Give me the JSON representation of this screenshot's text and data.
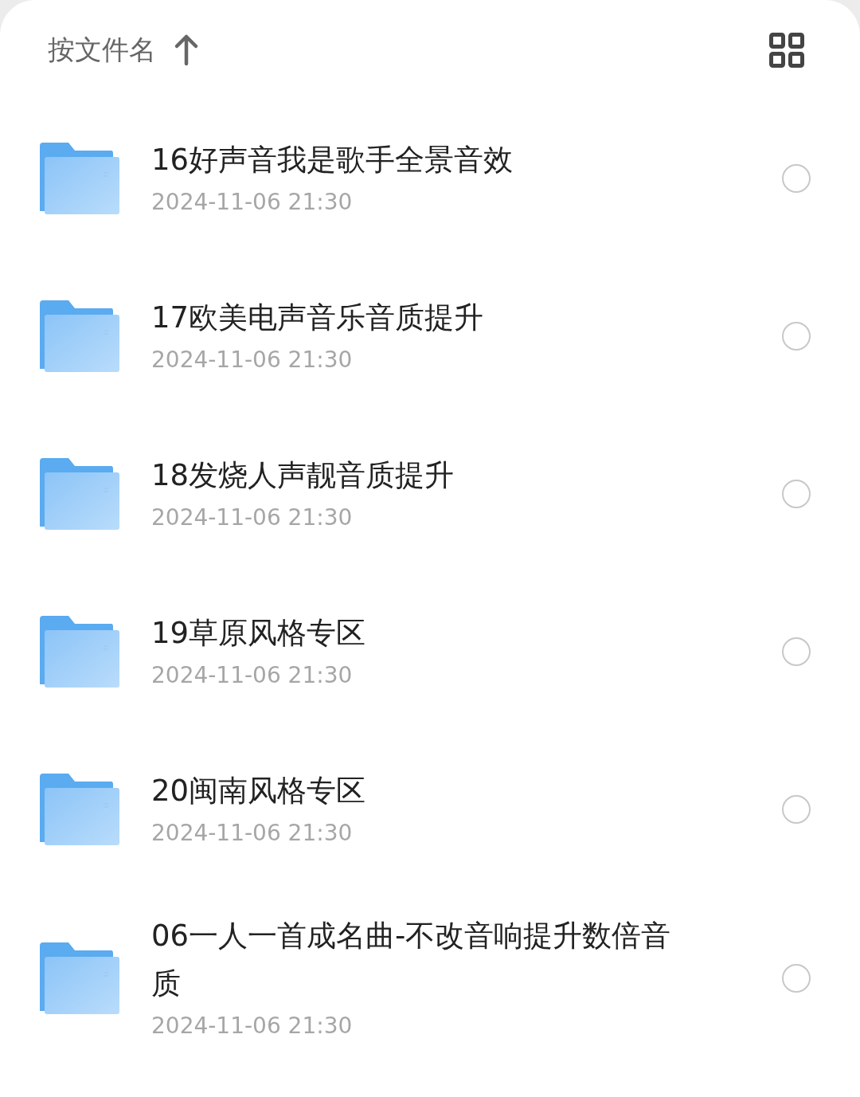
{
  "sort_bar": {
    "label": "按文件名",
    "ascending": true
  },
  "files": [
    {
      "name": "16好声音我是歌手全景音效",
      "date": "2024-11-06 21:30",
      "selected": false
    },
    {
      "name": "17欧美电声音乐音质提升",
      "date": "2024-11-06 21:30",
      "selected": false
    },
    {
      "name": "18发烧人声靓音质提升",
      "date": "2024-11-06 21:30",
      "selected": false
    },
    {
      "name": "19草原风格专区",
      "date": "2024-11-06 21:30",
      "selected": false
    },
    {
      "name": "20闽南风格专区",
      "date": "2024-11-06 21:30",
      "selected": false
    },
    {
      "name": "06一人一首成名曲-不改音响提升数倍音质",
      "date": "2024-11-06 21:30",
      "selected": false
    }
  ]
}
